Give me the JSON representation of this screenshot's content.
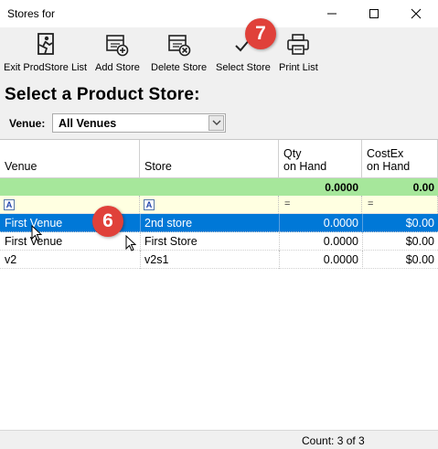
{
  "window": {
    "title": "Stores for"
  },
  "toolbar": {
    "items": [
      {
        "label": "Exit ProdStore List",
        "icon": "exit-icon"
      },
      {
        "label": "Add Store",
        "icon": "add-store-icon"
      },
      {
        "label": "Delete Store",
        "icon": "delete-store-icon"
      },
      {
        "label": "Select Store",
        "icon": "checkmark-icon"
      },
      {
        "label": "Print List",
        "icon": "printer-icon"
      }
    ]
  },
  "heading": "Select a Product Store:",
  "venue": {
    "label": "Venue:",
    "value": "All Venues"
  },
  "grid": {
    "columns": [
      {
        "label": "Venue"
      },
      {
        "label": "Store"
      },
      {
        "line1": "Qty",
        "line2": "on Hand"
      },
      {
        "line1": "CostEx",
        "line2": "on Hand"
      }
    ],
    "summary": {
      "qty": "0.0000",
      "cost": "0.00"
    },
    "filter": {
      "text_icon": "A",
      "eq": "="
    },
    "rows": [
      {
        "venue": "First Venue",
        "store": "2nd store",
        "qty": "0.0000",
        "cost": "$0.00",
        "selected": true
      },
      {
        "venue": "First Venue",
        "store": "First Store",
        "qty": "0.0000",
        "cost": "$0.00",
        "selected": false
      },
      {
        "venue": "v2",
        "store": "v2s1",
        "qty": "0.0000",
        "cost": "$0.00",
        "selected": false
      }
    ]
  },
  "status": {
    "count": "Count: 3 of 3"
  },
  "badges": {
    "select_store_step": "7",
    "row_step": "6"
  },
  "colors": {
    "selection": "#0078d7",
    "summary_row": "#a6e79b",
    "filter_row": "#ffffe1",
    "badge": "#e0413a"
  }
}
